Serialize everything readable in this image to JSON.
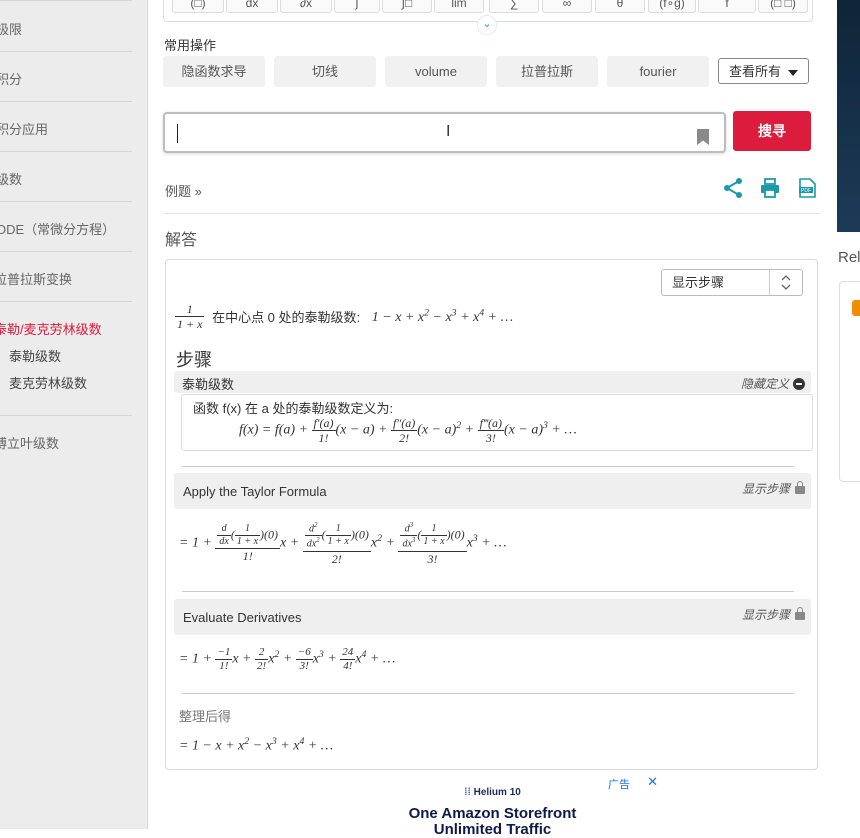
{
  "sidebar": {
    "items": [
      {
        "label": "极限"
      },
      {
        "label": "积分"
      },
      {
        "label": "积分应用"
      },
      {
        "label": "级数"
      },
      {
        "label": "ODE（常微分方程）"
      },
      {
        "label": "拉普拉斯变换"
      },
      {
        "label": "泰勒/麦克劳林级数",
        "active": true
      },
      {
        "label": "傅立叶级数"
      }
    ],
    "subitems": [
      {
        "label": "泰勒级数"
      },
      {
        "label": "麦克劳林级数"
      }
    ],
    "active_color": "#dc1c3c"
  },
  "toolbar": {
    "keys": [
      "(□)",
      "dx",
      "∂x",
      "∫",
      "∫□",
      "lim",
      "∑",
      "∞",
      "θ",
      "(f∘g)",
      "f",
      "(□ □)"
    ]
  },
  "common_ops": {
    "label": "常用操作",
    "buttons": [
      "隐函数求导",
      "切线",
      "volume",
      "拉普拉斯",
      "fourier"
    ],
    "view_all": "查看所有"
  },
  "search": {
    "value": "",
    "placeholder": "",
    "button": "搜寻",
    "button_color": "#dc1c3c"
  },
  "examples": {
    "label": "例题 »",
    "icons": [
      "share-icon",
      "print-icon",
      "pdf-icon"
    ],
    "icon_color": "#1a9aa8"
  },
  "answer": {
    "title": "解答",
    "step_select": "显示步骤",
    "result_text": "在中心点 0 处的泰勒级数:",
    "steps_title": "步骤",
    "definition_panel": {
      "title": "泰勒级数",
      "action": "隐藏定义",
      "text": "函数 f(x) 在 a 处的泰勒级数定义为:"
    },
    "step1": {
      "title": "Apply the Taylor Formula",
      "action": "显示步骤"
    },
    "step2": {
      "title": "Evaluate Derivatives",
      "action": "显示步骤"
    },
    "simplify_label": "整理后得"
  },
  "ad": {
    "label": "广告",
    "brand": "Helium 10",
    "headline": "One Amazon Storefront",
    "subline": "Unlimited Traffic"
  },
  "right_rail": {
    "label": "Rel"
  }
}
